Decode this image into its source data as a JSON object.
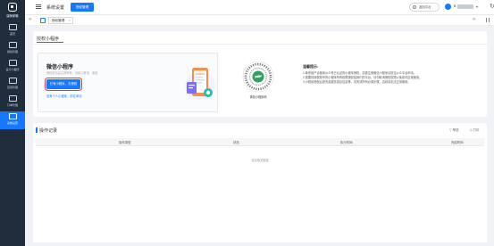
{
  "app": {
    "logo_text": "康师家嘛"
  },
  "sidebar": {
    "items": [
      {
        "label": "首页"
      },
      {
        "label": "授权管理"
      },
      {
        "label": "设计小程序"
      },
      {
        "label": "应用管理"
      },
      {
        "label": "订单管理"
      },
      {
        "label": "系统设置"
      }
    ]
  },
  "header": {
    "title": "系统设置",
    "button": "授权管理",
    "platform": "返回平台",
    "user_initial": "B",
    "caret": "▾",
    "refresh": "↻"
  },
  "tabs": {
    "prev": "«",
    "next": "»",
    "items": [
      {
        "label": "授权管理",
        "close": "×"
      }
    ]
  },
  "auth_panel": {
    "title": "授权小程序",
    "mini": {
      "title": "微信小程序",
      "subtitle": "授权成功后立即审核，请耐心等待，谢谢",
      "button": "已有小程序，去授权",
      "link": "没有个人小程序，前往申请"
    },
    "qr_caption": "体验小程序码",
    "tips_title": "温馨提示:",
    "tips": [
      "1.尊贵用户请使用公众号已认证的小程序授权，如需注册微信小程序请前往公众平台申请。",
      "2.需要将授权账号的小程序所有权限授权给我们的平台，请勿取消授权权限以免影响正常使用。",
      "3.小程序授权后需完善服务类目信息等，请完成所有必需步骤，否则将无法正常使用。"
    ]
  },
  "records": {
    "title": "操作记录",
    "filter": "筛选",
    "print": "打印",
    "columns": [
      "操作类型",
      "状态",
      "执行时间",
      "完成时间"
    ],
    "empty": "暂无相关数据"
  },
  "colors": {
    "primary": "#1677ff",
    "sidebar_bg": "#1f2d3d",
    "highlight": "#e53935",
    "page_bg": "#f0f2f5"
  }
}
